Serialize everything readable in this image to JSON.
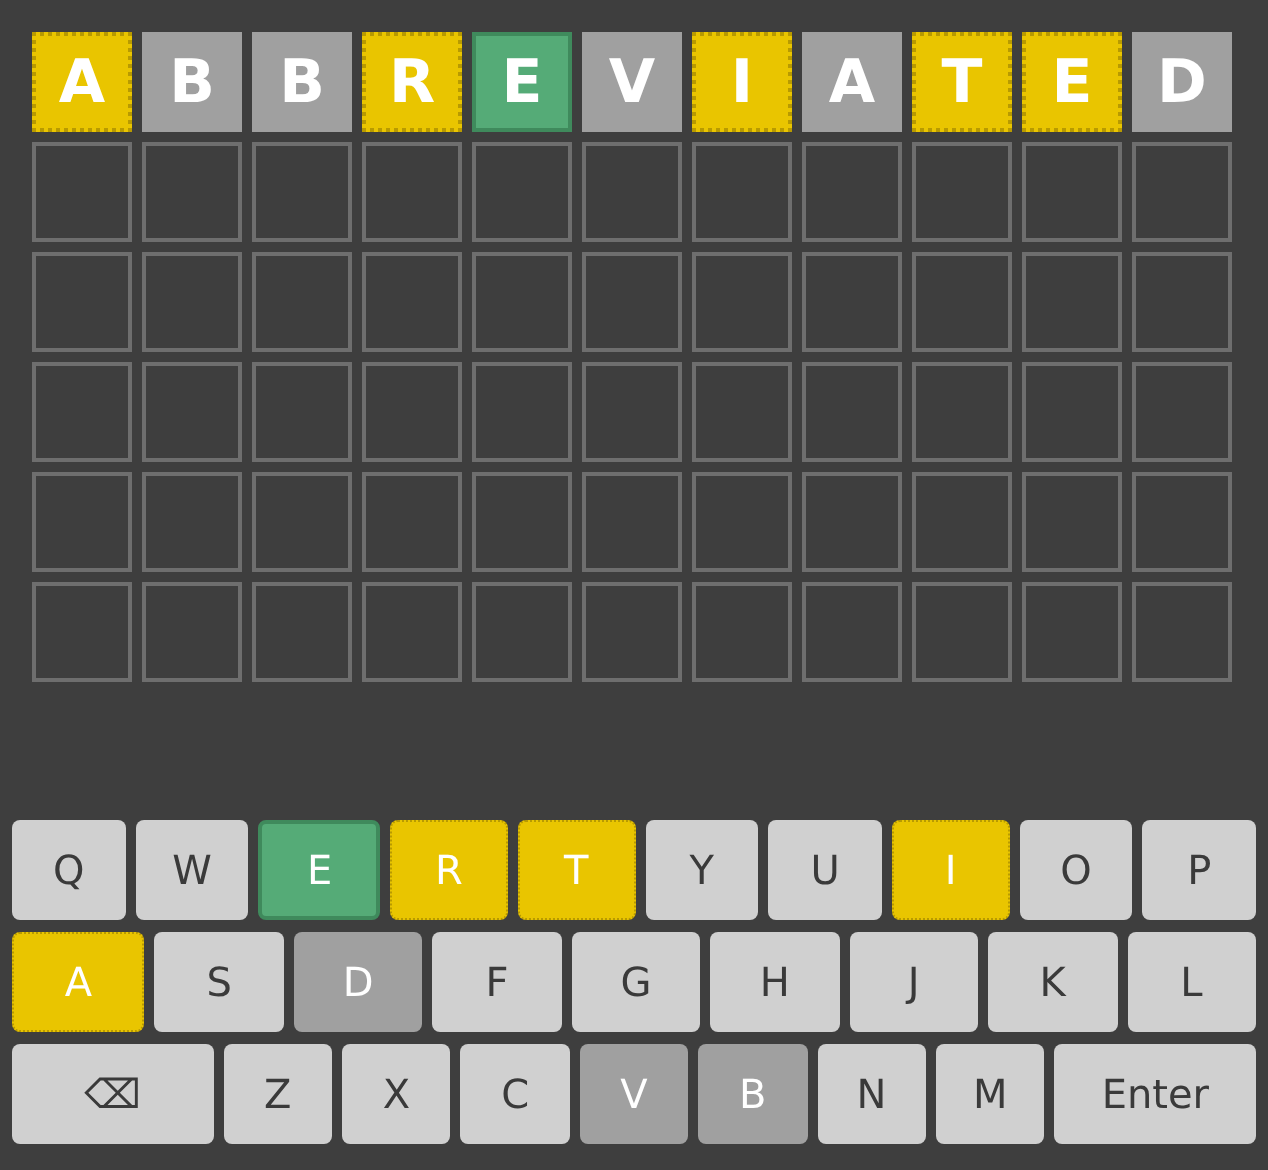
{
  "board": {
    "rows": [
      {
        "tiles": [
          {
            "letter": "A",
            "kind": "present"
          },
          {
            "letter": "B",
            "kind": "absent"
          },
          {
            "letter": "B",
            "kind": "absent"
          },
          {
            "letter": "R",
            "kind": "present"
          },
          {
            "letter": "E",
            "kind": "correct"
          },
          {
            "letter": "V",
            "kind": "absent"
          },
          {
            "letter": "I",
            "kind": "present"
          },
          {
            "letter": "A",
            "kind": "absent"
          },
          {
            "letter": "T",
            "kind": "present"
          },
          {
            "letter": "E",
            "kind": "present"
          },
          {
            "letter": "D",
            "kind": "absent"
          }
        ]
      },
      {
        "tiles": [
          {
            "kind": "empty"
          },
          {
            "kind": "empty"
          },
          {
            "kind": "empty"
          },
          {
            "kind": "empty"
          },
          {
            "kind": "empty"
          },
          {
            "kind": "empty"
          },
          {
            "kind": "empty"
          },
          {
            "kind": "empty"
          },
          {
            "kind": "empty"
          },
          {
            "kind": "empty"
          },
          {
            "kind": "empty"
          }
        ]
      },
      {
        "tiles": [
          {
            "kind": "empty"
          },
          {
            "kind": "empty"
          },
          {
            "kind": "empty"
          },
          {
            "kind": "empty"
          },
          {
            "kind": "empty"
          },
          {
            "kind": "empty"
          },
          {
            "kind": "empty"
          },
          {
            "kind": "empty"
          },
          {
            "kind": "empty"
          },
          {
            "kind": "empty"
          },
          {
            "kind": "empty"
          }
        ]
      },
      {
        "tiles": [
          {
            "kind": "empty"
          },
          {
            "kind": "empty"
          },
          {
            "kind": "empty"
          },
          {
            "kind": "empty"
          },
          {
            "kind": "empty"
          },
          {
            "kind": "empty"
          },
          {
            "kind": "empty"
          },
          {
            "kind": "empty"
          },
          {
            "kind": "empty"
          },
          {
            "kind": "empty"
          },
          {
            "kind": "empty"
          }
        ]
      },
      {
        "tiles": [
          {
            "kind": "empty"
          },
          {
            "kind": "empty"
          },
          {
            "kind": "empty"
          },
          {
            "kind": "empty"
          },
          {
            "kind": "empty"
          },
          {
            "kind": "empty"
          },
          {
            "kind": "empty"
          },
          {
            "kind": "empty"
          },
          {
            "kind": "empty"
          },
          {
            "kind": "empty"
          },
          {
            "kind": "empty"
          }
        ]
      },
      {
        "tiles": [
          {
            "kind": "empty"
          },
          {
            "kind": "empty"
          },
          {
            "kind": "empty"
          },
          {
            "kind": "empty"
          },
          {
            "kind": "empty"
          },
          {
            "kind": "empty"
          },
          {
            "kind": "empty"
          },
          {
            "kind": "empty"
          },
          {
            "kind": "empty"
          },
          {
            "kind": "empty"
          },
          {
            "kind": "empty"
          }
        ]
      }
    ]
  },
  "keyboard": {
    "rows": [
      {
        "keys": [
          {
            "label": "Q",
            "kind": "unused"
          },
          {
            "label": "W",
            "kind": "unused"
          },
          {
            "label": "E",
            "kind": "correct"
          },
          {
            "label": "R",
            "kind": "present"
          },
          {
            "label": "T",
            "kind": "present"
          },
          {
            "label": "Y",
            "kind": "unused"
          },
          {
            "label": "U",
            "kind": "unused"
          },
          {
            "label": "I",
            "kind": "present"
          },
          {
            "label": "O",
            "kind": "unused"
          },
          {
            "label": "P",
            "kind": "unused"
          }
        ]
      },
      {
        "keys": [
          {
            "label": "A",
            "kind": "present"
          },
          {
            "label": "S",
            "kind": "unused"
          },
          {
            "label": "D",
            "kind": "absent"
          },
          {
            "label": "F",
            "kind": "unused"
          },
          {
            "label": "G",
            "kind": "unused"
          },
          {
            "label": "H",
            "kind": "unused"
          },
          {
            "label": "J",
            "kind": "unused"
          },
          {
            "label": "K",
            "kind": "unused"
          },
          {
            "label": "L",
            "kind": "unused"
          }
        ]
      },
      {
        "keys": [
          {
            "label": "⌫",
            "kind": "wide"
          },
          {
            "label": "Z",
            "kind": "unused"
          },
          {
            "label": "X",
            "kind": "unused"
          },
          {
            "label": "C",
            "kind": "unused"
          },
          {
            "label": "V",
            "kind": "absent"
          },
          {
            "label": "B",
            "kind": "absent"
          },
          {
            "label": "N",
            "kind": "unused"
          },
          {
            "label": "M",
            "kind": "unused"
          },
          {
            "label": "Enter",
            "kind": "wide"
          }
        ]
      }
    ]
  }
}
